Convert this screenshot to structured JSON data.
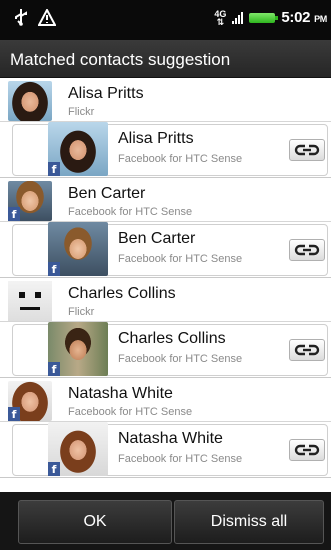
{
  "status_bar": {
    "network": "4G",
    "time": "5:02",
    "ampm": "PM"
  },
  "dialog": {
    "title": "Matched contacts suggestion"
  },
  "contacts": [
    {
      "name": "Alisa Pritts",
      "source": "Flickr",
      "avatar": "photo-woman-dark-hair-icon",
      "match": {
        "name": "Alisa Pritts",
        "source": "Facebook for HTC Sense",
        "avatar": "photo-woman-dark-hair-icon"
      }
    },
    {
      "name": "Ben Carter",
      "source": "Facebook for HTC Sense",
      "avatar": "photo-man-light-hair-icon",
      "match": {
        "name": "Ben Carter",
        "source": "Facebook for HTC Sense",
        "avatar": "photo-man-light-hair-icon"
      }
    },
    {
      "name": "Charles Collins",
      "source": "Flickr",
      "avatar": "robot-face-icon",
      "match": {
        "name": "Charles Collins",
        "source": "Facebook for HTC Sense",
        "avatar": "photo-man-dark-hair-icon"
      }
    },
    {
      "name": "Natasha White",
      "source": "Facebook for HTC Sense",
      "avatar": "photo-woman-red-hair-icon",
      "match": {
        "name": "Natasha White",
        "source": "Facebook for HTC Sense",
        "avatar": "photo-woman-red-hair-icon"
      }
    }
  ],
  "buttons": {
    "ok": "OK",
    "dismiss": "Dismiss all"
  },
  "colors": {
    "facebook": "#3b5998",
    "title_bar": "#2f2f2f",
    "bottom_bar": "#151515"
  }
}
